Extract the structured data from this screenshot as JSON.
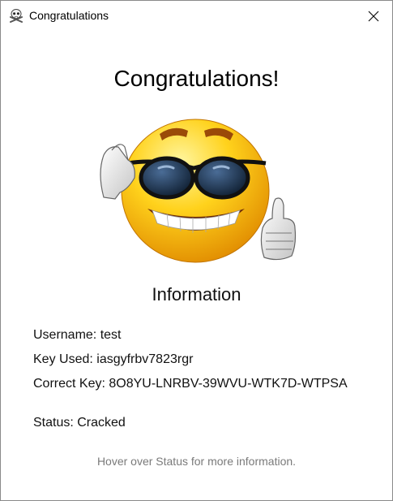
{
  "window": {
    "title": "Congratulations",
    "icon": "skull-crossbones-icon",
    "close_icon": "close-icon"
  },
  "main": {
    "heading": "Congratulations!",
    "image": "sunglasses-thumbs-up-emoji",
    "section_title": "Information",
    "info": {
      "username": "Username: test",
      "key_used": "Key Used: iasgyfrbv7823rgr",
      "correct_key": "Correct Key: 8O8YU-LNRBV-39WVU-WTK7D-WTPSA",
      "status": "Status: Cracked"
    },
    "hint": "Hover over Status for more information."
  },
  "colors": {
    "window_bg": "#ffffff",
    "desktop_accent": "#2a7fc4",
    "hint_text": "#7a7a7a",
    "close_hover": "#e81123"
  }
}
